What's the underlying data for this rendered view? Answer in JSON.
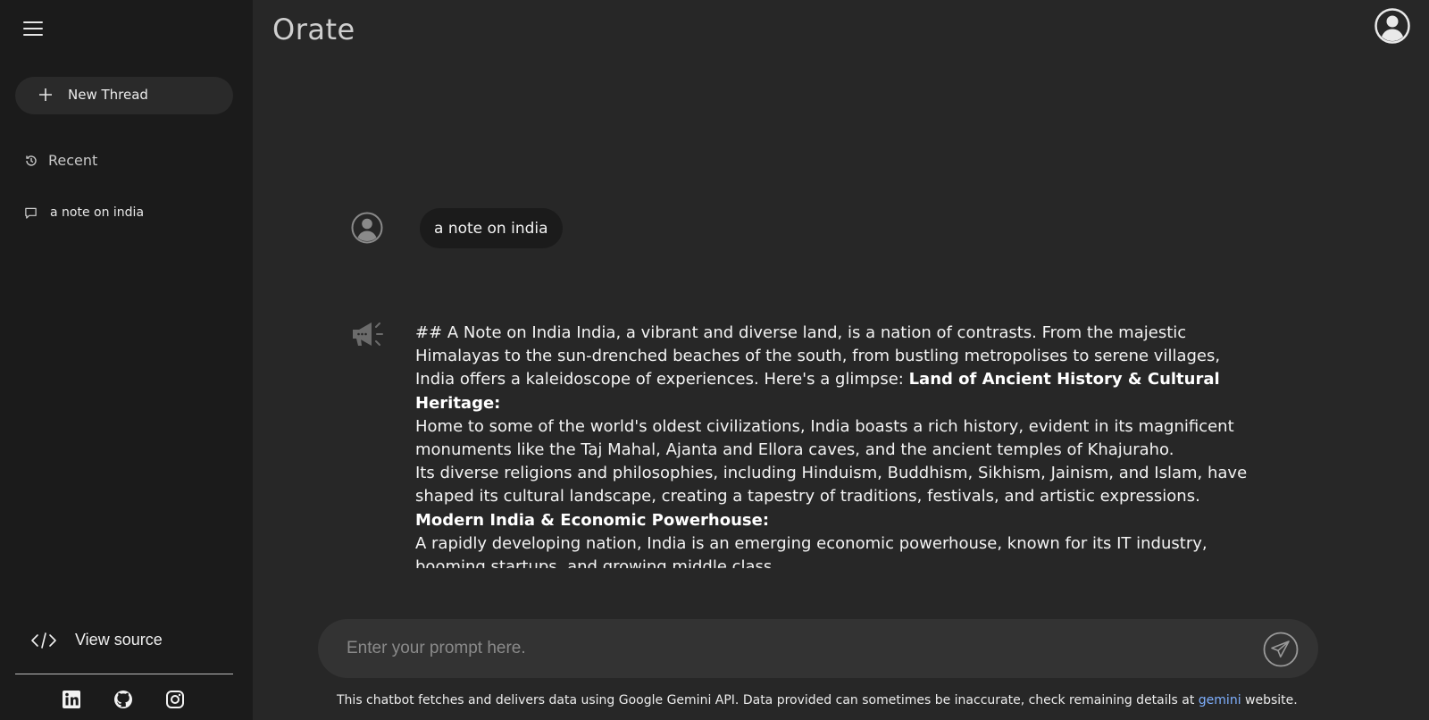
{
  "app": {
    "title": "Orate"
  },
  "sidebar": {
    "new_thread_label": "New Thread",
    "recent_label": "Recent",
    "threads": [
      {
        "label": "a note on india"
      }
    ],
    "view_source_label": "View source",
    "socials": [
      "linkedin-icon",
      "github-icon",
      "instagram-icon"
    ]
  },
  "chat": {
    "user_message": "a note on india",
    "response": {
      "intro": "## A Note on India India, a vibrant and diverse land, is a nation of contrasts. From the majestic Himalayas to the sun-drenched beaches of the south, from bustling metropolises to serene villages, India offers a kaleidoscope of experiences. Here's a glimpse: ",
      "heading1": "Land of Ancient History & Cultural Heritage:",
      "para1": "Home to some of the world's oldest civilizations, India boasts a rich history, evident in its magnificent monuments like the Taj Mahal, Ajanta and Ellora caves, and the ancient temples of Khajuraho.",
      "para2": "Its diverse religions and philosophies, including Hinduism, Buddhism, Sikhism, Jainism, and Islam, have shaped its cultural landscape, creating a tapestry of traditions, festivals, and artistic expressions.",
      "heading2": "Modern India & Economic Powerhouse:",
      "para3": "A rapidly developing nation, India is an emerging economic powerhouse, known for its IT industry, booming startups, and growing middle class."
    }
  },
  "prompt": {
    "placeholder": "Enter your prompt here."
  },
  "footer": {
    "text_before": "This chatbot fetches and delivers data using Google Gemini API. Data provided can sometimes be inaccurate, check remaining details at ",
    "link_text": "gemini",
    "text_after": " website."
  },
  "colors": {
    "sidebar_bg": "#1b1b1b",
    "main_bg": "#272727",
    "link": "#7fb0ff"
  }
}
